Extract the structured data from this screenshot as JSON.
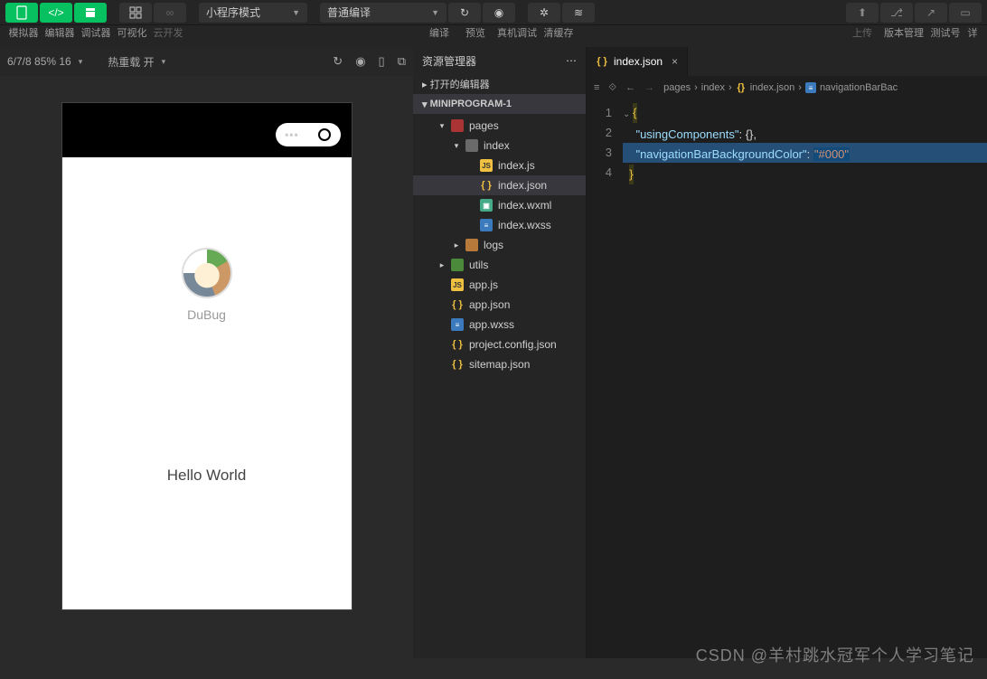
{
  "toolbar": {
    "mode": "小程序模式",
    "compile": "普通编译",
    "labels": {
      "sim": "模拟器",
      "editor": "编辑器",
      "debug": "调试器",
      "visual": "可视化",
      "cloud": "云开发",
      "compileBtn": "编译",
      "preview": "预览",
      "realdebug": "真机调试",
      "clearCache": "清缓存",
      "upload": "上传",
      "version": "版本管理",
      "testid": "测试号",
      "more": "详"
    }
  },
  "simbar": {
    "status": "6/7/8 85% 16",
    "hotreload": "热重载 开"
  },
  "phone": {
    "username": "DuBug",
    "hello": "Hello World"
  },
  "explorer": {
    "title": "资源管理器",
    "openEditors": "打开的编辑器",
    "project": "MINIPROGRAM-1",
    "nodes": {
      "pages": "pages",
      "index": "index",
      "indexjs": "index.js",
      "indexjson": "index.json",
      "indexwxml": "index.wxml",
      "indexwxss": "index.wxss",
      "logs": "logs",
      "utils": "utils",
      "appjs": "app.js",
      "appjson": "app.json",
      "appwxss": "app.wxss",
      "projectconfig": "project.config.json",
      "sitemap": "sitemap.json"
    }
  },
  "editor": {
    "tab": "index.json",
    "crumbs": {
      "a": "pages",
      "b": "index",
      "c": "index.json",
      "d": "navigationBarBac"
    },
    "code": {
      "l1": "{",
      "l2_key": "\"usingComponents\"",
      "l2_rest": ": {},",
      "l3_key": "\"navigationBarBackgroundColor\"",
      "l3_val": "\"#000\"",
      "l4": "}"
    }
  },
  "watermark": "CSDN @羊村跳水冠军个人学习笔记"
}
